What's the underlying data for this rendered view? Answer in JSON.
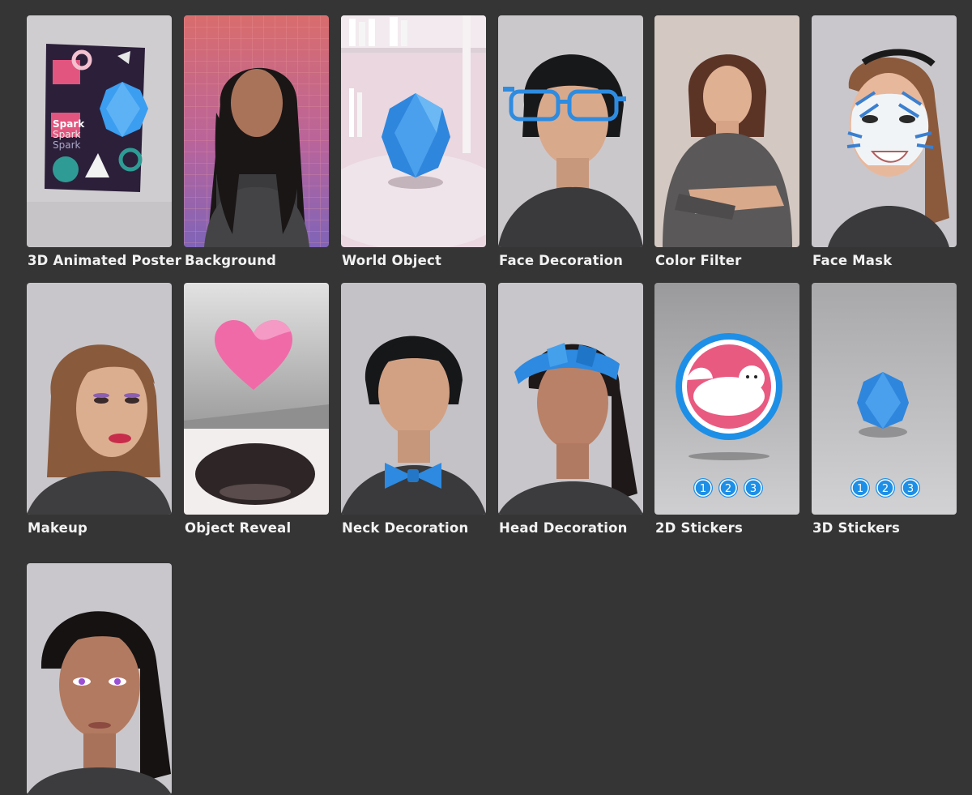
{
  "templates": [
    {
      "label": "3D Animated Poster",
      "poster_text": [
        "Spark",
        "Spark",
        "Spark"
      ]
    },
    {
      "label": "Background"
    },
    {
      "label": "World Object"
    },
    {
      "label": "Face Decoration"
    },
    {
      "label": "Color Filter"
    },
    {
      "label": "Face Mask"
    },
    {
      "label": "Makeup"
    },
    {
      "label": "Object Reveal"
    },
    {
      "label": "Neck Decoration"
    },
    {
      "label": "Head Decoration"
    },
    {
      "label": "2D Stickers",
      "steps": [
        "1",
        "2",
        "3"
      ]
    },
    {
      "label": "3D Stickers",
      "steps": [
        "1",
        "2",
        "3"
      ]
    },
    {
      "label": ""
    }
  ],
  "colors": {
    "background": "#353535",
    "label": "#f2f2f2",
    "accent_blue": "#1e8fe6",
    "heart_pink": "#f06aa8"
  }
}
